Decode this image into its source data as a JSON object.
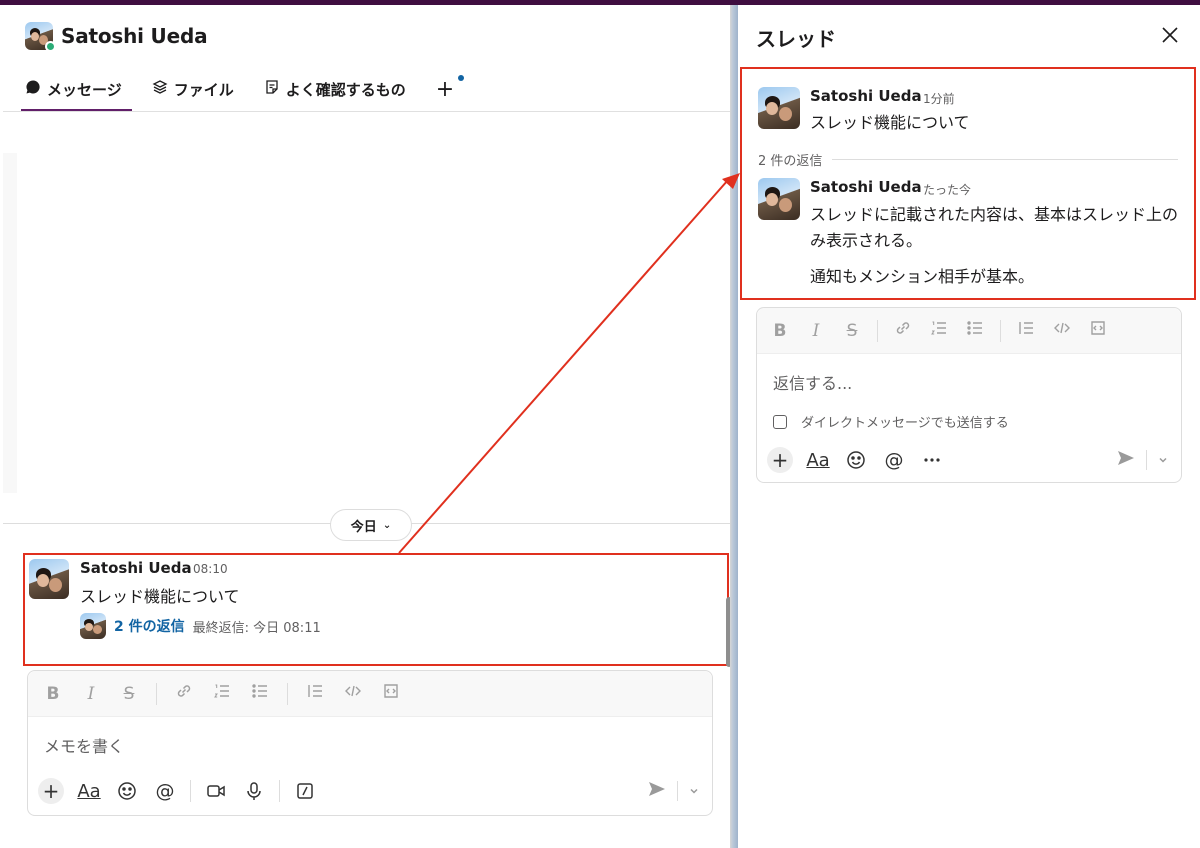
{
  "header": {
    "user_name": "Satoshi Ueda"
  },
  "tabs": [
    {
      "label": "メッセージ",
      "icon": "message-icon"
    },
    {
      "label": "ファイル",
      "icon": "layers-icon"
    },
    {
      "label": "よく確認するもの",
      "icon": "canvas-icon"
    }
  ],
  "tab_add": "+",
  "day_divider": {
    "label": "今日",
    "chevron": "⌄"
  },
  "message": {
    "author": "Satoshi Ueda",
    "time": "08:10",
    "text": "スレッド機能について",
    "reply_count_label": "2 件の返信",
    "last_reply_label": "最終返信: 今日 08:11"
  },
  "composer": {
    "placeholder": "メモを書く",
    "format_buttons": [
      "B",
      "I",
      "S"
    ]
  },
  "thread_panel": {
    "title": "スレッド",
    "parent": {
      "author": "Satoshi Ueda",
      "time": "1分前",
      "text": "スレッド機能について"
    },
    "replies_label": "2 件の返信",
    "reply": {
      "author": "Satoshi Ueda",
      "time": "たった今",
      "text_line1": "スレッドに記載された内容は、基本はスレッド上のみ表示される。",
      "text_line2": "通知もメンション相手が基本。"
    },
    "composer": {
      "placeholder": "返信する...",
      "dm_checkbox_label": "ダイレクトメッセージでも送信する",
      "checked": false
    }
  },
  "colors": {
    "highlight_border": "#e0301e",
    "link": "#1264a3",
    "presence": "#2bac76",
    "active_tab": "#611f69"
  }
}
